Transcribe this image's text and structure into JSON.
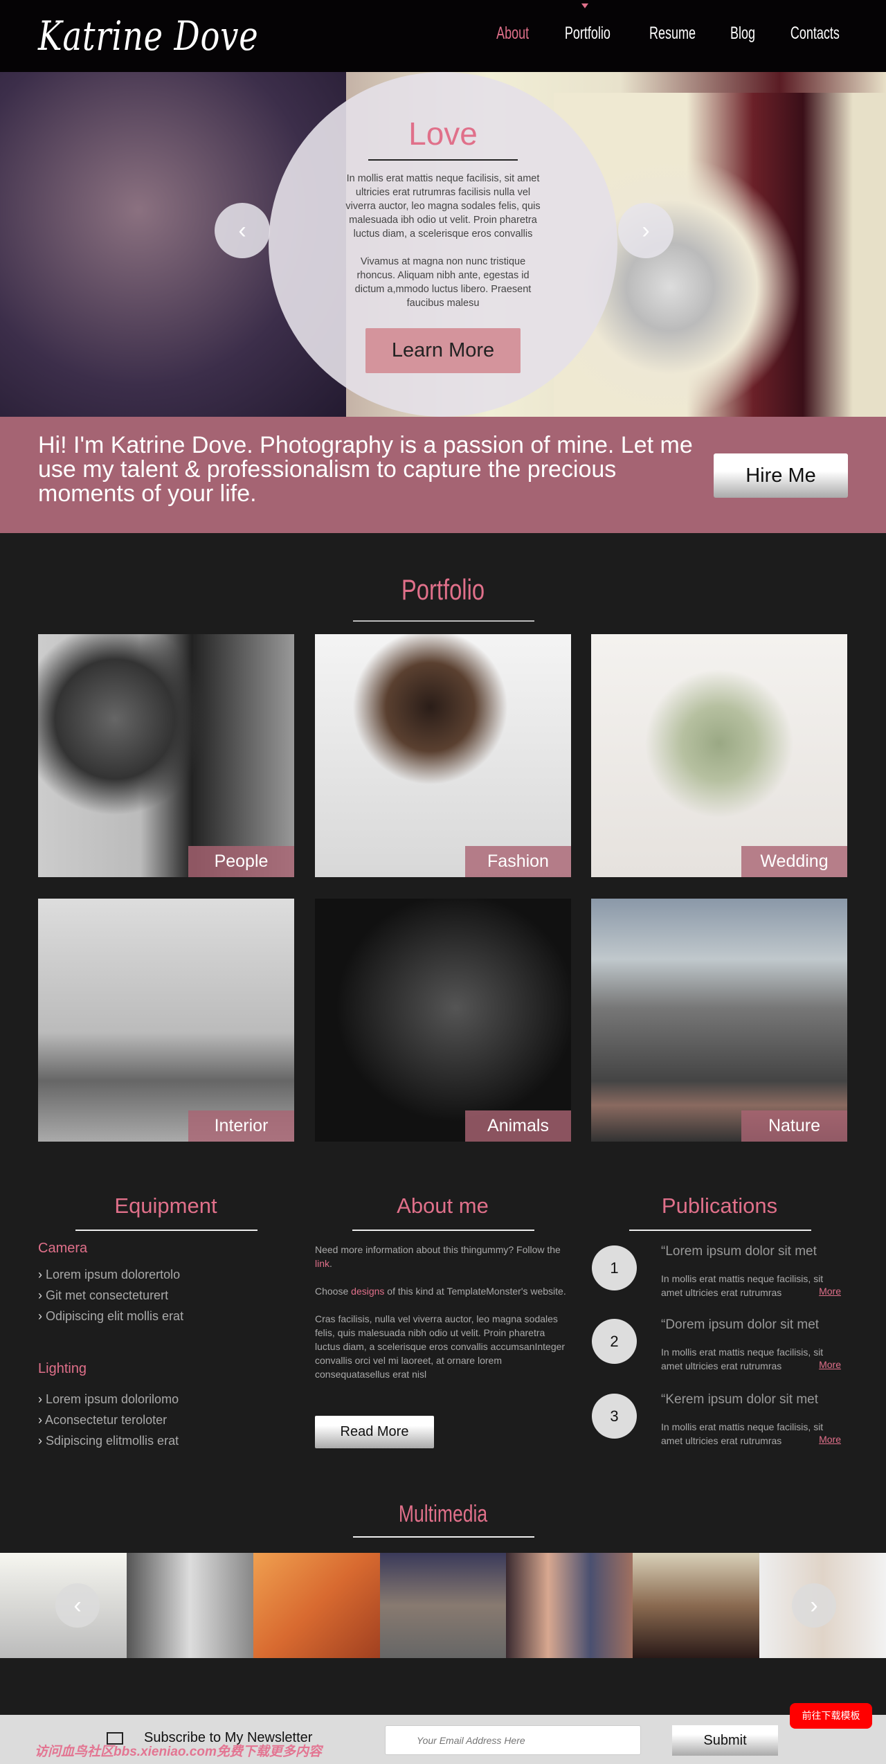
{
  "header": {
    "logo": "Katrine Dove",
    "nav": [
      {
        "label": "About",
        "active": true
      },
      {
        "label": "Portfolio"
      },
      {
        "label": "Resume"
      },
      {
        "label": "Blog"
      },
      {
        "label": "Contacts"
      }
    ]
  },
  "hero": {
    "title": "Love",
    "p1": "In mollis erat mattis neque facilisis, sit amet ultricies erat rutrumras facilisis nulla vel viverra auctor, leo magna sodales felis, quis malesuada ibh odio ut velit. Proin pharetra luctus diam, a scelerisque eros convallis",
    "p2": "Vivamus at magna non nunc tristique rhoncus. Aliquam nibh ante, egestas id dictum a,mmodo luctus libero. Praesent faucibus malesu",
    "button": "Learn More",
    "prev": "‹",
    "next": "›"
  },
  "banner": {
    "text": "Hi! I'm Katrine Dove. Photography is a passion of mine. Let me use my talent & professionalism to capture the precious moments of your life.",
    "button": "Hire Me"
  },
  "portfolio": {
    "title": "Portfolio",
    "tiles": [
      "People",
      "Fashion",
      "Wedding",
      "Interior",
      "Animals",
      "Nature"
    ]
  },
  "equipment": {
    "title": "Equipment",
    "camera": {
      "title": "Camera",
      "items": [
        "Lorem ipsum dolorertolo",
        "Git met consecteturert",
        "Odipiscing elit mollis erat"
      ]
    },
    "lighting": {
      "title": "Lighting",
      "items": [
        "Lorem ipsum dolorilomo",
        "Aconsectetur teroloter",
        "Sdipiscing elitmollis erat"
      ]
    }
  },
  "about": {
    "title": "About me",
    "p1_a": "Need more information about this thingummy? Follow the ",
    "p1_link": "link",
    "p1_b": ".",
    "p2_a": "Choose ",
    "p2_link": "designs",
    "p2_b": " of this kind at TemplateMonster's website.",
    "p3": "Cras facilisis, nulla vel viverra auctor, leo magna sodales felis, quis malesuada nibh odio ut velit. Proin pharetra luctus diam, a scelerisque eros convallis accumsanInteger convallis orci vel mi laoreet, at ornare lorem consequatasellus erat nisl",
    "button": "Read More"
  },
  "publications": {
    "title": "Publications",
    "items": [
      {
        "num": "1",
        "quote": "“Lorem ipsum dolor sit met",
        "desc": "In mollis erat mattis neque facilisis, sit amet ultricies erat rutrumras",
        "more": "More"
      },
      {
        "num": "2",
        "quote": "“Dorem ipsum dolor sit met",
        "desc": "In mollis erat mattis neque facilisis, sit amet ultricies erat rutrumras",
        "more": "More"
      },
      {
        "num": "3",
        "quote": "“Kerem ipsum dolor sit met",
        "desc": "In mollis erat mattis neque facilisis, sit amet ultricies erat rutrumras",
        "more": "More"
      }
    ]
  },
  "multimedia": {
    "title": "Multimedia",
    "prev": "‹",
    "next": "›"
  },
  "footer": {
    "newsletter": "Subscribe to My Newsletter",
    "email_placeholder": "Your Email Address Here",
    "submit": "Submit",
    "watermark": "访问血鸟社区bbs.xieniao.com免费下载更多内容",
    "download": "前往下载模板"
  },
  "colors": {
    "accent": "#e0708a",
    "banner": "#a56473",
    "background": "#1c1c1c",
    "header": "#050305"
  }
}
